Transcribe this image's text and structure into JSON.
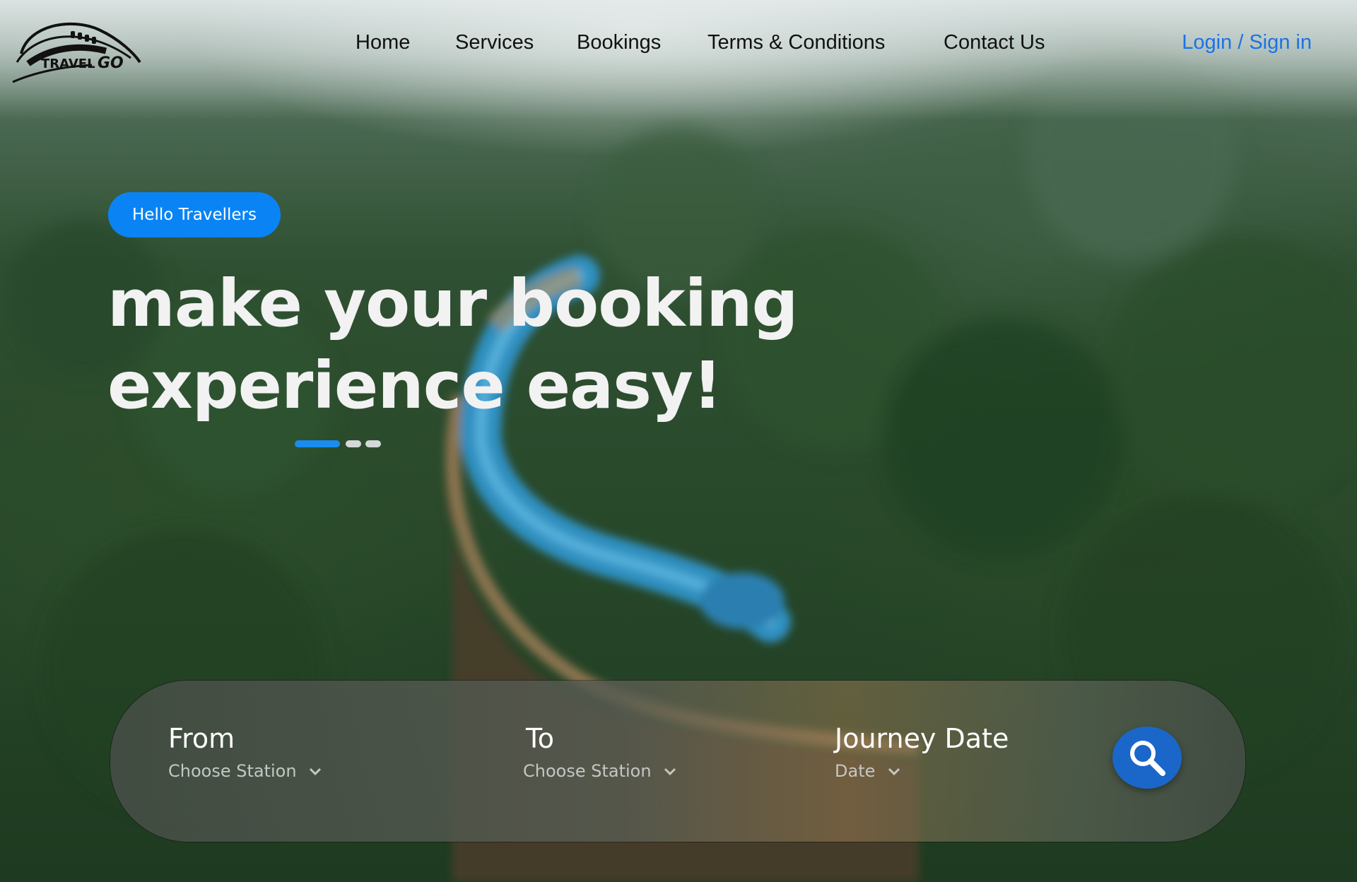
{
  "brand": {
    "name": "TRAVELGO"
  },
  "nav": {
    "items": [
      {
        "label": "Home"
      },
      {
        "label": "Services"
      },
      {
        "label": "Bookings"
      },
      {
        "label": "Terms & Conditions"
      },
      {
        "label": "Contact Us"
      }
    ],
    "login_label": "Login / Sign in"
  },
  "hero": {
    "badge": "Hello Travellers",
    "headline_line1": "make your booking",
    "headline_line2": "experience easy!",
    "slider": {
      "count": 3,
      "active_index": 0
    }
  },
  "search": {
    "from": {
      "label": "From",
      "placeholder": "Choose Station"
    },
    "to": {
      "label": "To",
      "placeholder": "Choose Station"
    },
    "date": {
      "label": "Journey Date",
      "placeholder": "Date"
    },
    "button_icon": "search-icon"
  },
  "colors": {
    "accent": "#0a84f5",
    "login": "#1a73e8",
    "search_button": "#1a67c9"
  }
}
